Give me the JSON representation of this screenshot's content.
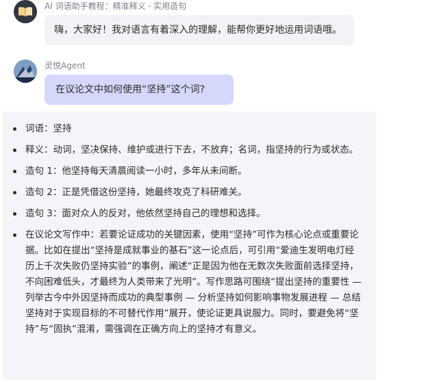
{
  "bot_message": {
    "name": "AI 词语助手教程：精准释义 · 实用造句",
    "text": "嗨，大家好！我对语言有着深入的理解，能帮你更好地运用词语哦。"
  },
  "user_message": {
    "name": "灵悦Agent",
    "text": "在议论文中如何使用“坚持”这个词?"
  },
  "answer": {
    "items": [
      "词语：坚持",
      "释义：动词，坚决保持、维护或进行下去，不放弃；名词，指坚持的行为或状态。",
      "造句 1：他坚持每天清晨阅读一小时，多年从未间断。",
      "造句 2：正是凭借这份坚持，她最终攻克了科研难关。",
      "造句 3：面对众人的反对，他依然坚持自己的理想和选择。",
      "在议论文写作中：若要论证成功的关键因素，使用“坚持”可作为核心论点或重要论据。比如在提出“坚持是成就事业的基石”这一论点后，可引用“爱迪生发明电灯经历上千次失败仍坚持实验”的事例，阐述“正是因为他在无数次失败面前选择坚持，不向困难低头，才最终为人类带来了光明”。写作思路可围绕“提出坚持的重要性 — 列举古今中外因坚持而成功的典型事例 — 分析坚持如何影响事物发展进程 — 总结坚持对于实现目标的不可替代作用”展开，使论证更具说服力。同时，要避免将“坚持”与“固执”混淆，需强调在正确方向上的坚持才有意义。"
    ]
  },
  "icons": {
    "bot_avatar": "open-book-icon",
    "user_avatar": "agent-avatar-icon"
  },
  "colors": {
    "user_bubble": "#d5d7fb",
    "bot_bubble": "#f2f3f6",
    "answer_bg": "#f4f5f9"
  }
}
